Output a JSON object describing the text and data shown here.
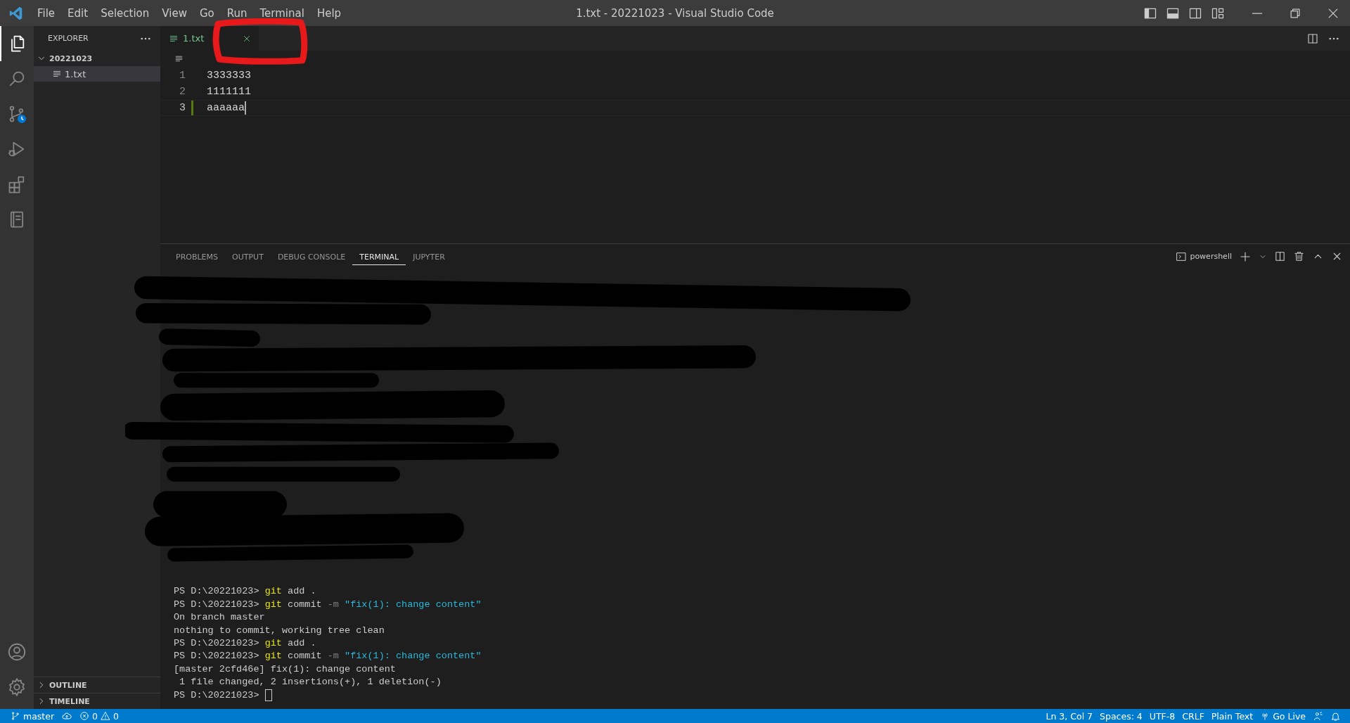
{
  "title_bar": {
    "menus": [
      "File",
      "Edit",
      "Selection",
      "View",
      "Go",
      "Run",
      "Terminal",
      "Help"
    ],
    "title": "1.txt - 20221023 - Visual Studio Code"
  },
  "activity_bar": {
    "items": [
      {
        "kind": "files",
        "selected": true
      },
      {
        "kind": "search",
        "selected": false
      },
      {
        "kind": "source-control",
        "selected": false
      },
      {
        "kind": "run",
        "selected": false
      },
      {
        "kind": "extensions",
        "selected": false
      },
      {
        "kind": "notebook",
        "selected": false
      }
    ],
    "bottom": [
      {
        "kind": "account"
      },
      {
        "kind": "settings"
      }
    ]
  },
  "sidebar": {
    "title": "EXPLORER",
    "folder": {
      "name": "20221023",
      "expanded": true,
      "children": [
        {
          "name": "1.txt",
          "selected": true
        }
      ]
    },
    "sections": [
      {
        "label": "OUTLINE",
        "expanded": false
      },
      {
        "label": "TIMELINE",
        "expanded": false
      }
    ]
  },
  "editor": {
    "tabs": [
      {
        "label": "1.txt",
        "selected": true
      }
    ],
    "lines": [
      {
        "number": "1",
        "text": "3333333",
        "current": false,
        "modified": false
      },
      {
        "number": "2",
        "text": "1111111",
        "current": false,
        "modified": false
      },
      {
        "number": "3",
        "text": "aaaaaa",
        "current": true,
        "modified": true
      }
    ]
  },
  "panel": {
    "tabs": [
      {
        "label": "PROBLEMS",
        "selected": false
      },
      {
        "label": "OUTPUT",
        "selected": false
      },
      {
        "label": "DEBUG CONSOLE",
        "selected": false
      },
      {
        "label": "TERMINAL",
        "selected": true
      },
      {
        "label": "JUPYTER",
        "selected": false
      }
    ],
    "shell": "powershell",
    "terminal_lines": [
      {
        "cursor": false,
        "segments": [
          {
            "kind": "prompt",
            "text": "PS D:\\20221023> "
          },
          {
            "kind": "command",
            "text": "git"
          },
          {
            "kind": "arg",
            "text": " add ."
          }
        ]
      },
      {
        "cursor": false,
        "segments": [
          {
            "kind": "prompt",
            "text": "PS D:\\20221023> "
          },
          {
            "kind": "command",
            "text": "git"
          },
          {
            "kind": "arg",
            "text": " commit "
          },
          {
            "kind": "flag",
            "text": "-m"
          },
          {
            "kind": "string",
            "text": " \"fix(1): change content\""
          }
        ]
      },
      {
        "cursor": false,
        "segments": [
          {
            "kind": "output",
            "text": "On branch master"
          }
        ]
      },
      {
        "cursor": false,
        "segments": [
          {
            "kind": "output",
            "text": "nothing to commit, working tree clean"
          }
        ]
      },
      {
        "cursor": false,
        "segments": [
          {
            "kind": "prompt",
            "text": "PS D:\\20221023> "
          },
          {
            "kind": "command",
            "text": "git"
          },
          {
            "kind": "arg",
            "text": " add ."
          }
        ]
      },
      {
        "cursor": false,
        "segments": [
          {
            "kind": "prompt",
            "text": "PS D:\\20221023> "
          },
          {
            "kind": "command",
            "text": "git"
          },
          {
            "kind": "arg",
            "text": " commit "
          },
          {
            "kind": "flag",
            "text": "-m"
          },
          {
            "kind": "string",
            "text": " \"fix(1): change content\""
          }
        ]
      },
      {
        "cursor": false,
        "segments": [
          {
            "kind": "output",
            "text": "[master 2cfd46e] fix(1): change content"
          }
        ]
      },
      {
        "cursor": false,
        "segments": [
          {
            "kind": "output",
            "text": " 1 file changed, 2 insertions(+), 1 deletion(-)"
          }
        ]
      },
      {
        "cursor": true,
        "segments": [
          {
            "kind": "prompt",
            "text": "PS D:\\20221023> "
          }
        ]
      }
    ]
  },
  "status_bar": {
    "branch": "master",
    "errors": "0",
    "warnings": "0",
    "items": [
      "Ln 3, Col 7",
      "Spaces: 4",
      "UTF-8",
      "CRLF",
      "Plain Text"
    ],
    "live": "Go Live"
  }
}
